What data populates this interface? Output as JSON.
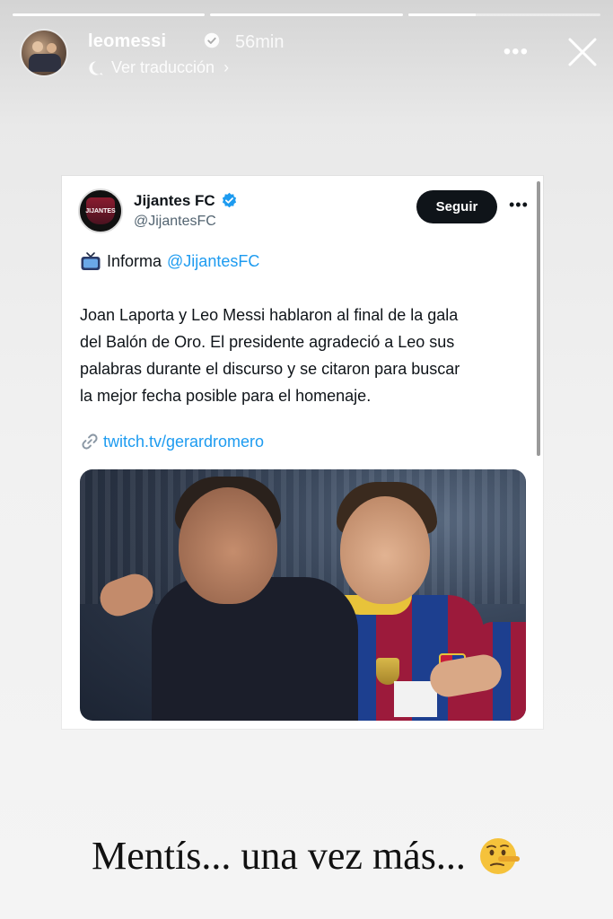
{
  "story": {
    "progress_segments": [
      1.0,
      1.0,
      0.35
    ],
    "username": "leomessi",
    "time_ago": "56min",
    "translate_label": "Ver traducción",
    "chevron": "›",
    "more_label": "•••",
    "icons": [
      "verified-badge-icon",
      "translate-bubble-icon",
      "more-icon",
      "close-icon"
    ]
  },
  "tweet": {
    "display_name": "Jijantes FC",
    "handle": "@JijantesFC",
    "follow_label": "Seguir",
    "more_label": "•••",
    "avatar_crest_text": "JIJANTES",
    "informa_prefix": "Informa",
    "informa_mention": "@JijantesFC",
    "body": "Joan Laporta y Leo Messi hablaron al final de la gala\ndel Balón de Oro. El presidente agradeció a Leo sus\npalabras  durante el discurso y se citaron para buscar\nla mejor fecha posible para el homenaje.",
    "link": "twitch.tv/gerardromero",
    "colors": {
      "link": "#1d9bf0",
      "text": "#0f1419",
      "handle": "#536471"
    }
  },
  "caption": {
    "text": "Mentís... una vez más...",
    "emoji": "lying-face-emoji"
  }
}
